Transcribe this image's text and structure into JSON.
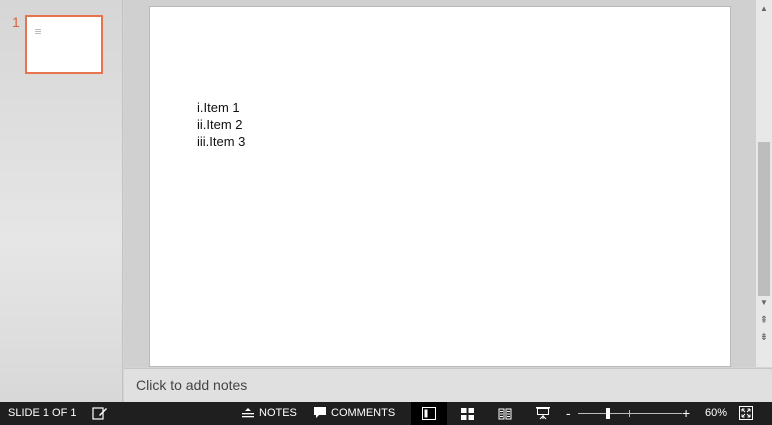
{
  "thumbnails": {
    "slide_number": "1"
  },
  "slide": {
    "list_items": [
      "i.Item 1",
      "ii.Item 2",
      "iii.Item 3"
    ]
  },
  "notes": {
    "placeholder": "Click to add notes"
  },
  "status_bar": {
    "slide_indicator": "SLIDE 1 OF 1",
    "notes_label": "NOTES",
    "comments_label": "COMMENTS",
    "zoom_percent": "60%",
    "zoom_minus": "-",
    "zoom_plus": "+",
    "zoom_level": 0.29
  },
  "icons": {
    "notes_toggle": "notes-pencil-icon",
    "notes_button": "notes-icon",
    "comments_button": "comment-bubble-icon",
    "normal_view": "normal-view-icon",
    "slide_sorter": "slide-sorter-icon",
    "reading_view": "reading-view-icon",
    "slideshow": "slideshow-icon",
    "fit_to_window": "fit-to-window-icon"
  },
  "colors": {
    "selection_border": "#e8744f",
    "slide_number": "#d9613f",
    "status_bar_bg": "#1f1f1f"
  }
}
